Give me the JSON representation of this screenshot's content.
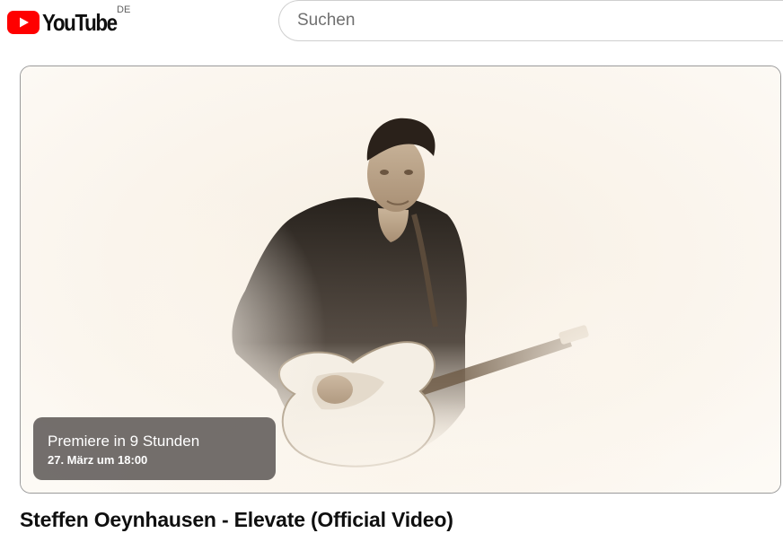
{
  "header": {
    "logo_text": "YouTube",
    "country_code": "DE",
    "logo_icon": "youtube-play-icon",
    "brand_color": "#ff0000"
  },
  "search": {
    "placeholder": "Suchen",
    "value": ""
  },
  "player": {
    "thumbnail_description": "sepia-toned foggy shot of a guitarist playing a white electric guitar",
    "premiere": {
      "title": "Premiere in 9 Stunden",
      "date": "27. März um 18:00"
    }
  },
  "video": {
    "title": "Steffen Oeynhausen - Elevate (Official Video)"
  }
}
